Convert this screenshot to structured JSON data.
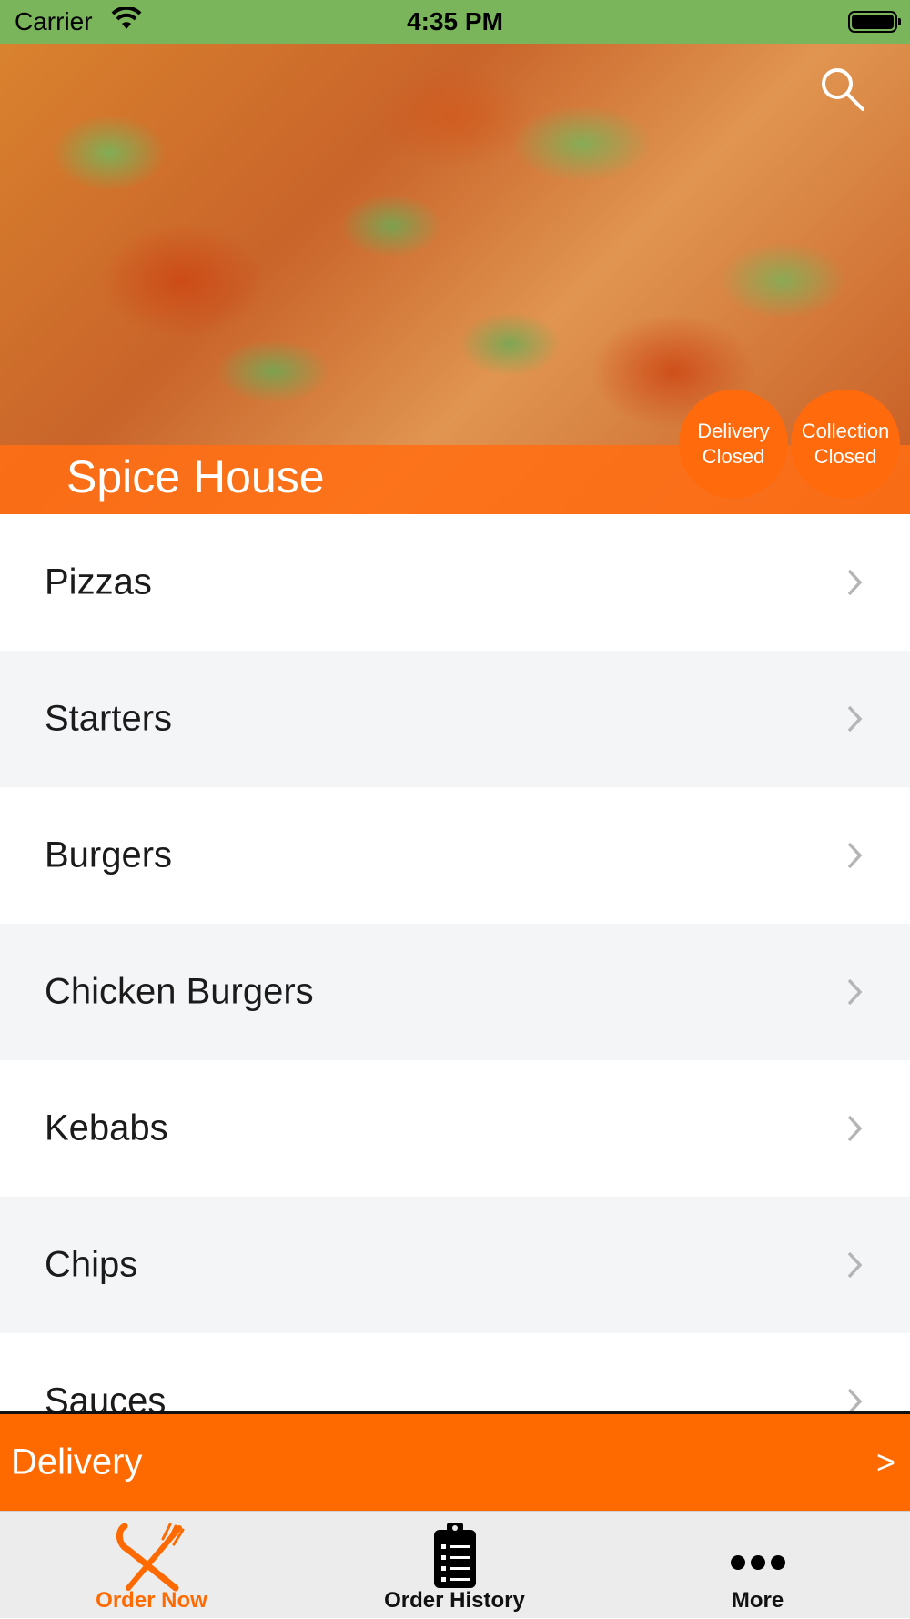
{
  "status_bar": {
    "carrier": "Carrier",
    "time": "4:35 PM"
  },
  "header": {
    "restaurant_name": "Spice House",
    "delivery_status": {
      "title": "Delivery",
      "state": "Closed"
    },
    "collection_status": {
      "title": "Collection",
      "state": "Closed"
    }
  },
  "menu": {
    "categories": [
      {
        "label": "Pizzas"
      },
      {
        "label": "Starters"
      },
      {
        "label": "Burgers"
      },
      {
        "label": "Chicken Burgers"
      },
      {
        "label": "Kebabs"
      },
      {
        "label": "Chips"
      },
      {
        "label": "Sauces"
      }
    ]
  },
  "order_type_bar": {
    "label": "Delivery",
    "arrow": ">"
  },
  "tab_bar": {
    "tabs": [
      {
        "label": "Order Now",
        "icon": "fork-knife-icon",
        "active": true
      },
      {
        "label": "Order History",
        "icon": "clipboard-icon",
        "active": false
      },
      {
        "label": "More",
        "icon": "more-dots-icon",
        "active": false
      }
    ]
  },
  "colors": {
    "status_bar_bg": "#7ab55c",
    "accent": "#ff6a00",
    "tab_bar_bg": "#ececec",
    "alt_row_bg": "#f4f5f7"
  }
}
